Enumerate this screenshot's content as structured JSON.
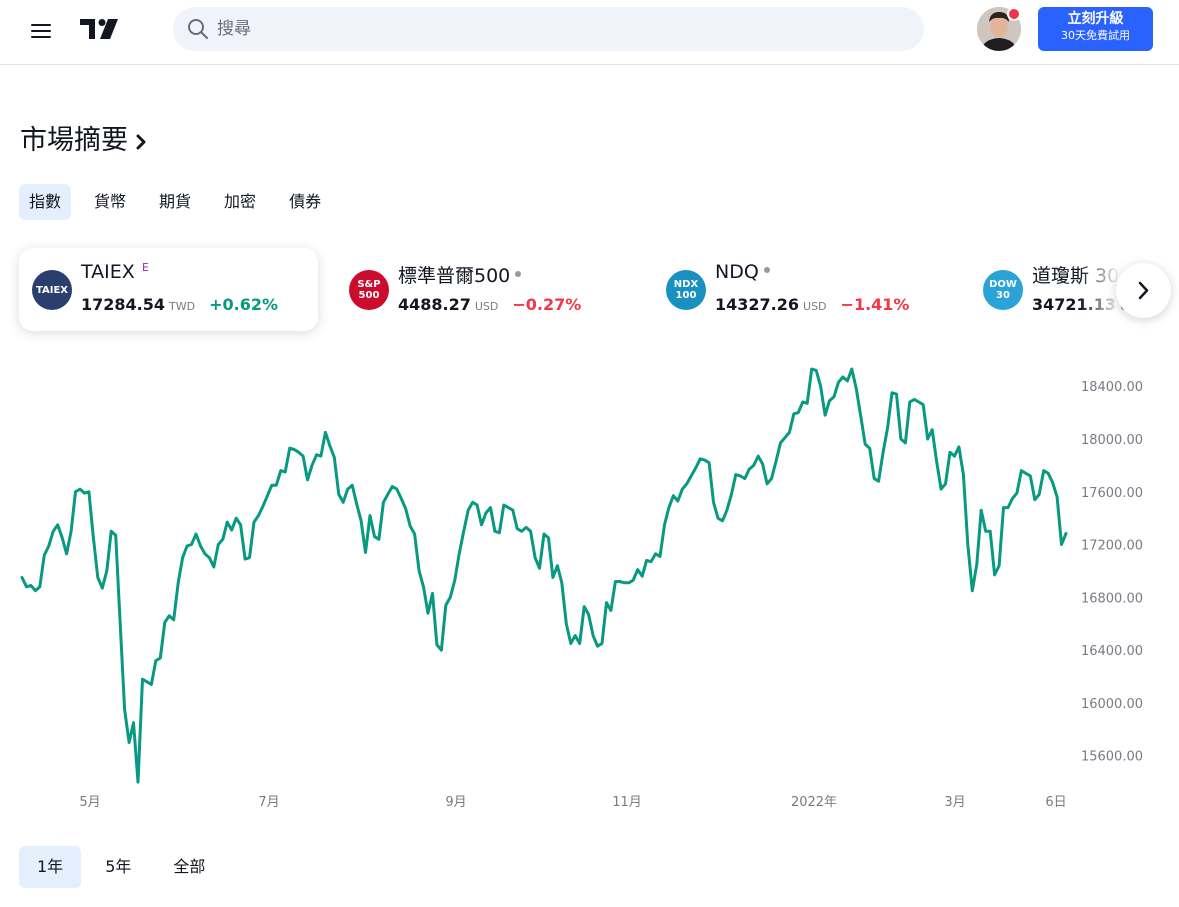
{
  "header": {
    "search_placeholder": "搜尋",
    "upgrade_label": "立刻升級",
    "upgrade_sub": "30天免費試用"
  },
  "page_title": "市場摘要",
  "tabs": [
    {
      "label": "指數",
      "active": true
    },
    {
      "label": "貨幣",
      "active": false
    },
    {
      "label": "期貨",
      "active": false
    },
    {
      "label": "加密",
      "active": false
    },
    {
      "label": "債券",
      "active": false
    }
  ],
  "tickers": [
    {
      "logo": "TAIEX",
      "name": "TAIEX",
      "sup": "E",
      "price": "17284.54",
      "currency": "TWD",
      "change": "+0.62%",
      "direction": "up",
      "logo_color": "#2a3f6e"
    },
    {
      "logo": "S&P 500",
      "name": "標準普爾500",
      "price": "4488.27",
      "currency": "USD",
      "change": "−0.27%",
      "direction": "down",
      "logo_color": "#cc0c2f"
    },
    {
      "logo": "NDX 100",
      "name": "NDQ",
      "price": "14327.26",
      "currency": "USD",
      "change": "−1.41%",
      "direction": "down",
      "logo_color": "#1a8fc2"
    },
    {
      "logo": "DOW 30",
      "name": "道瓊斯 30",
      "price": "34721.13",
      "currency": "USD",
      "change": "",
      "direction": "up",
      "logo_color": "#2aa3d6"
    }
  ],
  "ranges": [
    {
      "label": "1年",
      "active": true
    },
    {
      "label": "5年",
      "active": false
    },
    {
      "label": "全部",
      "active": false
    }
  ],
  "chart_data": {
    "type": "line",
    "series": [
      {
        "color": "#089981",
        "values": [
          16950,
          16880,
          16890,
          16850,
          16880,
          17120,
          17190,
          17300,
          17350,
          17250,
          17130,
          17300,
          17600,
          17620,
          17590,
          17600,
          17250,
          16950,
          16870,
          17000,
          17300,
          17270,
          16600,
          15950,
          15700,
          15850,
          15400,
          16180,
          16160,
          16140,
          16320,
          16340,
          16610,
          16660,
          16630,
          16910,
          17100,
          17190,
          17200,
          17280,
          17190,
          17130,
          17100,
          17030,
          17200,
          17240,
          17370,
          17310,
          17400,
          17350,
          17090,
          17100,
          17370,
          17420,
          17490,
          17570,
          17650,
          17650,
          17760,
          17750,
          17930,
          17920,
          17900,
          17870,
          17690,
          17800,
          17880,
          17870,
          18050,
          17950,
          17860,
          17580,
          17520,
          17620,
          17650,
          17510,
          17380,
          17140,
          17420,
          17260,
          17240,
          17520,
          17580,
          17640,
          17620,
          17550,
          17470,
          17340,
          17280,
          17000,
          16880,
          16680,
          16830,
          16440,
          16400,
          16740,
          16800,
          16930,
          17130,
          17300,
          17460,
          17520,
          17500,
          17350,
          17440,
          17480,
          17300,
          17290,
          17500,
          17480,
          17460,
          17320,
          17300,
          17330,
          17300,
          17100,
          17020,
          17280,
          17250,
          16950,
          17040,
          16910,
          16600,
          16450,
          16510,
          16450,
          16730,
          16670,
          16510,
          16430,
          16450,
          16760,
          16700,
          16920,
          16920,
          16910,
          16910,
          16930,
          17010,
          16960,
          17080,
          17070,
          17130,
          17110,
          17350,
          17480,
          17570,
          17530,
          17620,
          17660,
          17720,
          17780,
          17850,
          17840,
          17820,
          17520,
          17400,
          17380,
          17460,
          17580,
          17730,
          17720,
          17700,
          17770,
          17800,
          17870,
          17810,
          17660,
          17700,
          17830,
          17970,
          18010,
          18050,
          18190,
          18200,
          18280,
          18270,
          18530,
          18520,
          18400,
          18180,
          18290,
          18320,
          18430,
          18470,
          18440,
          18530,
          18380,
          18170,
          17960,
          17930,
          17700,
          17680,
          17900,
          18080,
          18350,
          18340,
          18000,
          17970,
          18280,
          18300,
          18280,
          18260,
          18000,
          18070,
          17830,
          17620,
          17660,
          17900,
          17870,
          17940,
          17730,
          17200,
          16850,
          17050,
          17460,
          17300,
          17300,
          16970,
          17040,
          17480,
          17480,
          17550,
          17590,
          17760,
          17740,
          17720,
          17540,
          17580,
          17760,
          17740,
          17670,
          17560,
          17200,
          17284
        ]
      }
    ],
    "x_ticks": [
      "5月",
      "7月",
      "9月",
      "11月",
      "2022年",
      "3月",
      "6日"
    ],
    "y_ticks": [
      "15600.00",
      "16000.00",
      "16400.00",
      "16800.00",
      "17200.00",
      "17600.00",
      "18000.00",
      "18400.00"
    ],
    "ylim": [
      15340,
      18750
    ],
    "grid": false
  }
}
